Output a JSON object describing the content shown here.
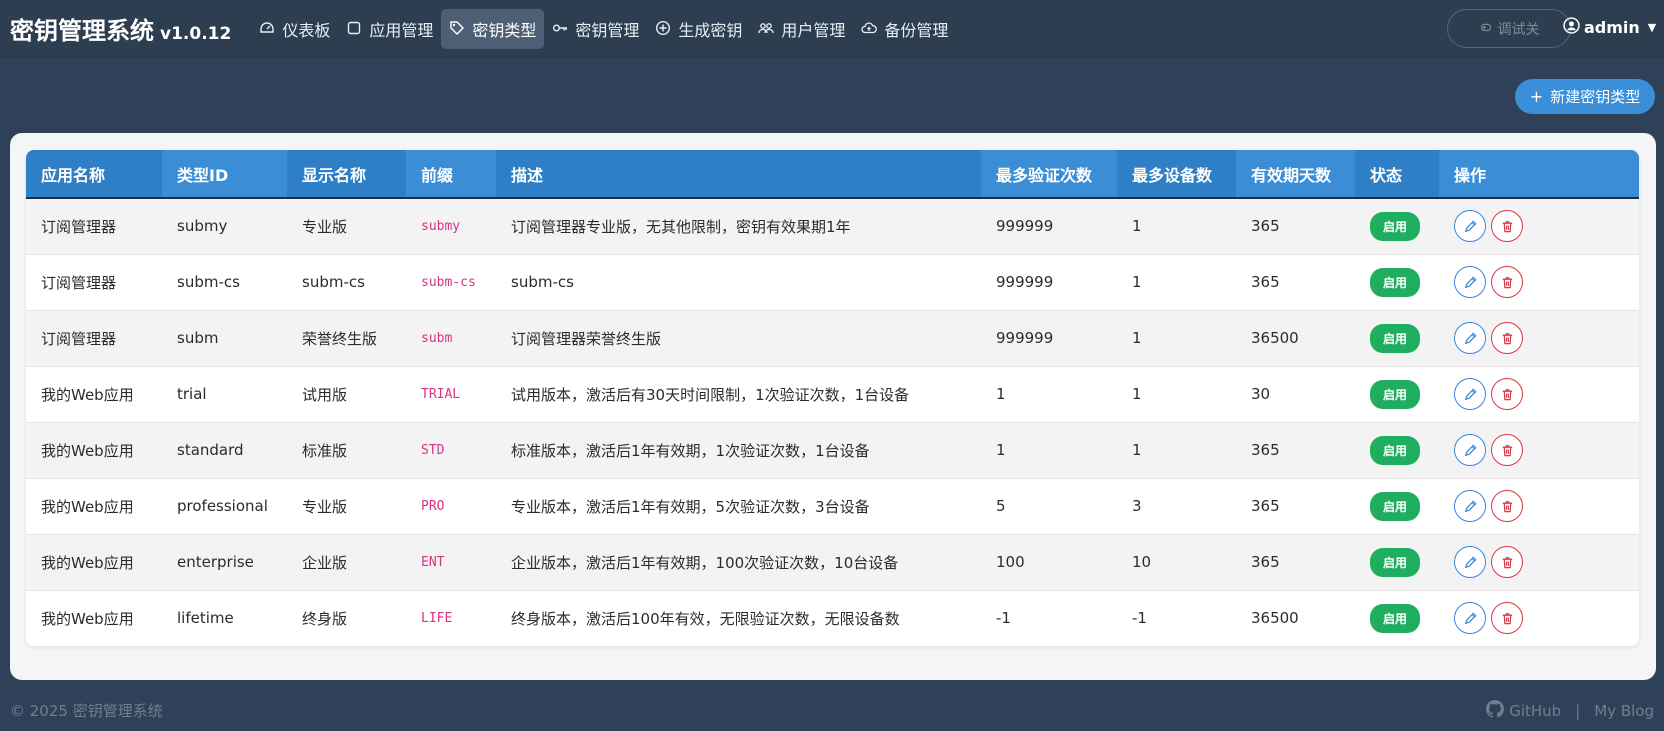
{
  "navbar": {
    "brand": "密钥管理系统",
    "version": "v1.0.12",
    "items": [
      {
        "label": "仪表板",
        "icon": "dashboard-icon",
        "active": false
      },
      {
        "label": "应用管理",
        "icon": "square-icon",
        "active": false
      },
      {
        "label": "密钥类型",
        "icon": "tag-icon",
        "active": true
      },
      {
        "label": "密钥管理",
        "icon": "key-icon",
        "active": false
      },
      {
        "label": "生成密钥",
        "icon": "plus-circle-icon",
        "active": false
      },
      {
        "label": "用户管理",
        "icon": "people-icon",
        "active": false
      },
      {
        "label": "备份管理",
        "icon": "cloud-upload-icon",
        "active": false
      }
    ],
    "debug_label": "调试关",
    "user": "admin"
  },
  "toolbar": {
    "new_label": "新建密钥类型"
  },
  "table": {
    "headers": [
      "应用名称",
      "类型ID",
      "显示名称",
      "前缀",
      "描述",
      "最多验证次数",
      "最多设备数",
      "有效期天数",
      "状态",
      "操作"
    ],
    "rows": [
      {
        "app": "订阅管理器",
        "type_id": "submy",
        "display": "专业版",
        "prefix": "submy",
        "desc": "订阅管理器专业版，无其他限制，密钥有效果期1年",
        "max_verify": "999999",
        "max_devices": "1",
        "days": "365",
        "status": "启用"
      },
      {
        "app": "订阅管理器",
        "type_id": "subm-cs",
        "display": "subm-cs",
        "prefix": "subm-cs",
        "desc": "subm-cs",
        "max_verify": "999999",
        "max_devices": "1",
        "days": "365",
        "status": "启用"
      },
      {
        "app": "订阅管理器",
        "type_id": "subm",
        "display": "荣誉终生版",
        "prefix": "subm",
        "desc": "订阅管理器荣誉终生版",
        "max_verify": "999999",
        "max_devices": "1",
        "days": "36500",
        "status": "启用"
      },
      {
        "app": "我的Web应用",
        "type_id": "trial",
        "display": "试用版",
        "prefix": "TRIAL",
        "desc": "试用版本，激活后有30天时间限制，1次验证次数，1台设备",
        "max_verify": "1",
        "max_devices": "1",
        "days": "30",
        "status": "启用"
      },
      {
        "app": "我的Web应用",
        "type_id": "standard",
        "display": "标准版",
        "prefix": "STD",
        "desc": "标准版本，激活后1年有效期，1次验证次数，1台设备",
        "max_verify": "1",
        "max_devices": "1",
        "days": "365",
        "status": "启用"
      },
      {
        "app": "我的Web应用",
        "type_id": "professional",
        "display": "专业版",
        "prefix": "PRO",
        "desc": "专业版本，激活后1年有效期，5次验证次数，3台设备",
        "max_verify": "5",
        "max_devices": "3",
        "days": "365",
        "status": "启用"
      },
      {
        "app": "我的Web应用",
        "type_id": "enterprise",
        "display": "企业版",
        "prefix": "ENT",
        "desc": "企业版本，激活后1年有效期，100次验证次数，10台设备",
        "max_verify": "100",
        "max_devices": "10",
        "days": "365",
        "status": "启用"
      },
      {
        "app": "我的Web应用",
        "type_id": "lifetime",
        "display": "终身版",
        "prefix": "LIFE",
        "desc": "终身版本，激活后100年有效，无限验证次数，无限设备数",
        "max_verify": "-1",
        "max_devices": "-1",
        "days": "36500",
        "status": "启用"
      }
    ]
  },
  "footer": {
    "copyright": "© 2025 密钥管理系统",
    "github": "GitHub",
    "separator": "|",
    "blog": "My Blog"
  },
  "colors": {
    "navbar_bg": "#2c3e50",
    "page_bg": "#2e4158",
    "header_blue": "#3b8ed6",
    "status_green": "#1fae60",
    "edit_blue": "#3a84dc",
    "delete_red": "#dc3545",
    "prefix_pink": "#d63384"
  }
}
